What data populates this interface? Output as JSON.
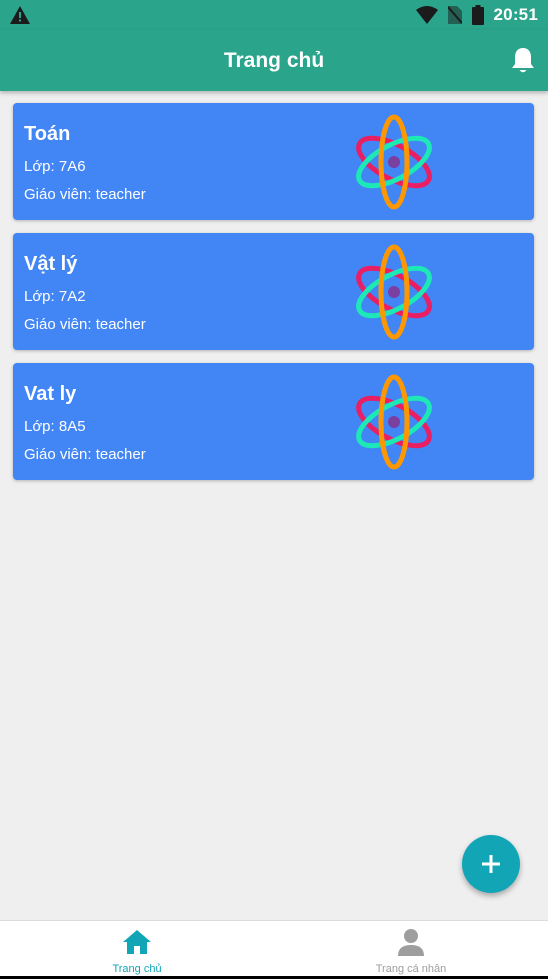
{
  "status_bar": {
    "time": "20:51",
    "icons": [
      "warning-icon",
      "wifi-icon",
      "no-sim-icon",
      "battery-icon"
    ]
  },
  "app_bar": {
    "title": "Trang chủ",
    "action_icon": "bell-icon"
  },
  "courses": [
    {
      "name": "Toán",
      "class_line": "Lớp: 7A6",
      "teacher_line": "Giáo viên: teacher",
      "icon": "atom-icon"
    },
    {
      "name": "Vật lý",
      "class_line": "Lớp: 7A2",
      "teacher_line": "Giáo viên: teacher",
      "icon": "atom-icon"
    },
    {
      "name": "Vat ly",
      "class_line": "Lớp: 8A5",
      "teacher_line": "Giáo viên: teacher",
      "icon": "atom-icon"
    }
  ],
  "fab": {
    "icon": "plus-icon"
  },
  "bottom_nav": {
    "items": [
      {
        "label": "Trang chủ",
        "icon": "home-icon",
        "active": true
      },
      {
        "label": "Trang cá nhân",
        "icon": "person-icon",
        "active": false
      }
    ]
  },
  "colors": {
    "primary": "#2aa48a",
    "card": "#4285f4",
    "accent": "#12a5b6",
    "background": "#efefef"
  }
}
